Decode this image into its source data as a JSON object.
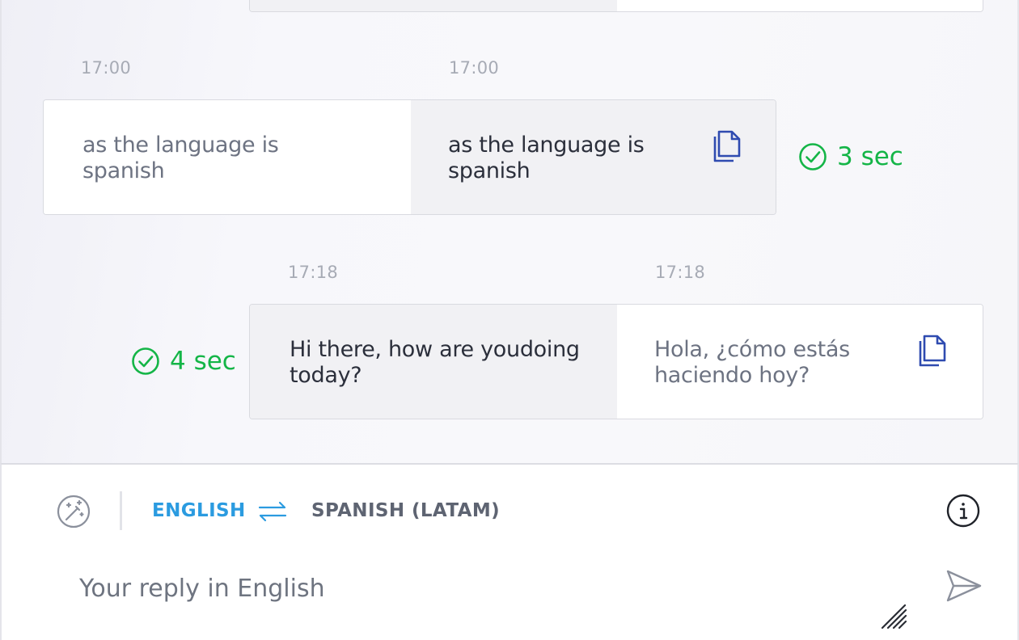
{
  "messages": [
    {
      "source_time": "17:00",
      "target_time": "17:00",
      "source_text": "as the language is spanish",
      "target_text": "as the language is spanish",
      "status": "3 sec",
      "copy_icon": "copy-icon",
      "status_icon": "check-circle-icon"
    },
    {
      "source_time": "17:18",
      "target_time": "17:18",
      "source_text": "Hi there, how are youdoing today?",
      "target_text": "Hola, ¿cómo estás haciendo hoy?",
      "status": "4 sec",
      "copy_icon": "copy-icon",
      "status_icon": "check-circle-icon"
    }
  ],
  "composer": {
    "source_language": "ENGLISH",
    "target_language": "SPANISH (LATAM)",
    "placeholder": "Your reply in English",
    "icons": [
      "magic-wand-icon",
      "swap-arrows-icon",
      "info-icon",
      "send-icon",
      "resize-handle-icon"
    ]
  },
  "colors": {
    "accent_blue": "#2b9be0",
    "success_green": "#14b547",
    "copy_icon_blue": "#2f4bb0"
  }
}
